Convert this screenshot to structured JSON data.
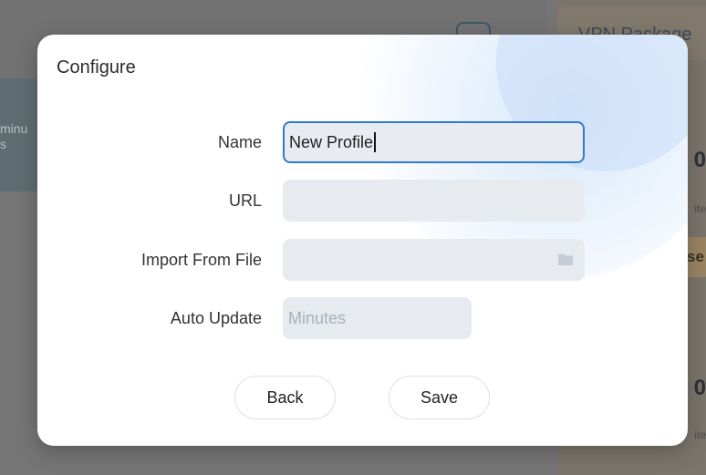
{
  "background": {
    "left_snippet_line1": "minu",
    "left_snippet_line2": "s",
    "right_title": "VPN Package",
    "right_frag_1": "0",
    "right_small_1": "ite",
    "right_chip": "se",
    "right_frag_2": "0",
    "right_small_2": "ite"
  },
  "dialog": {
    "title": "Configure",
    "fields": {
      "name": {
        "label": "Name",
        "value": "New Profile"
      },
      "url": {
        "label": "URL",
        "value": ""
      },
      "import": {
        "label": "Import From File",
        "value": "",
        "icon": "folder-icon"
      },
      "auto_update": {
        "label": "Auto Update",
        "placeholder": "Minutes"
      }
    },
    "buttons": {
      "back": "Back",
      "save": "Save"
    }
  },
  "colors": {
    "focus_border": "#2f7bd1",
    "field_bg": "#e7ebf0",
    "placeholder": "#a9b1bb"
  }
}
